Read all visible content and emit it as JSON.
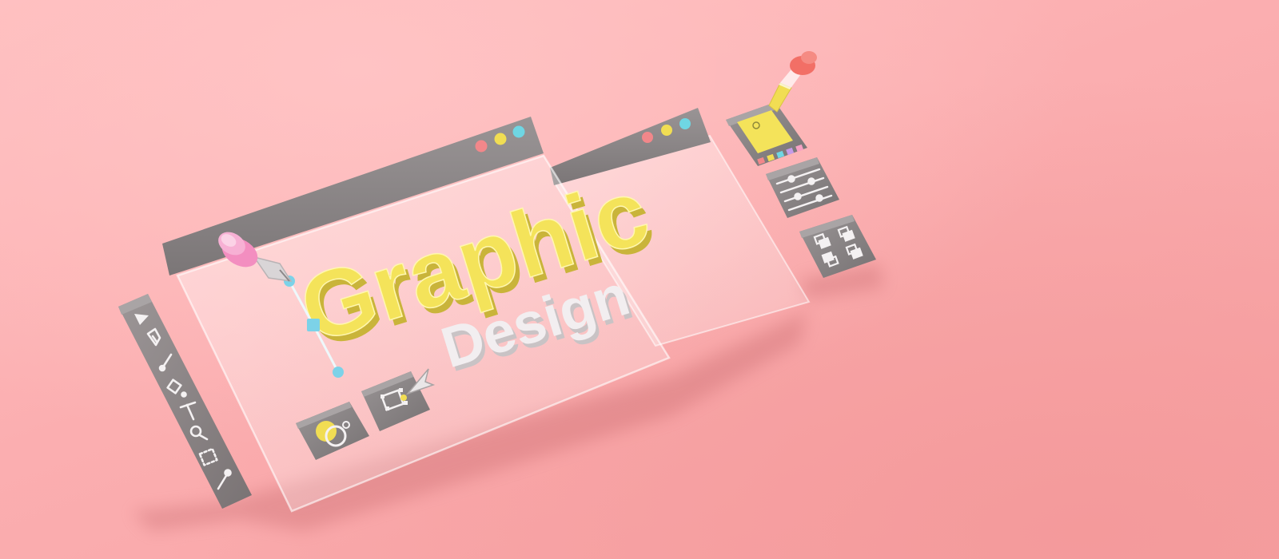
{
  "illustration": {
    "headline_line1": "Graphic",
    "headline_line2": "Design",
    "colors": {
      "background": "#fbb3b4",
      "window_bar": "#8a8586",
      "yellow": "#f4e35a",
      "white_text": "#f2eef0",
      "dot_red": "#f2878a",
      "dot_yellow": "#f1dd53",
      "dot_blue": "#6fd6e3",
      "handle_blue": "#7cd2e8"
    },
    "back_window": {
      "controls": [
        "close-dot",
        "minimize-dot",
        "maximize-dot"
      ]
    },
    "front_window": {
      "controls": [
        "close-dot",
        "minimize-dot",
        "maximize-dot"
      ]
    },
    "left_toolbar": {
      "tools": [
        "select-arrow-icon",
        "pen-tool-icon",
        "brush-icon",
        "paint-bucket-icon",
        "text-tool-icon",
        "zoom-icon",
        "marquee-select-icon",
        "eyedropper-icon"
      ]
    },
    "right_panels": {
      "color_picker_swatches": [
        "#f2878a",
        "#f1dd53",
        "#6fd6e3",
        "#c59be8",
        "#f7a1c4"
      ],
      "tools": [
        "color-picker-panel",
        "adjustment-sliders-icon",
        "layers-arrange-icon"
      ]
    },
    "bottom_tiles": [
      "shape-merge-icon",
      "transform-select-icon"
    ]
  }
}
